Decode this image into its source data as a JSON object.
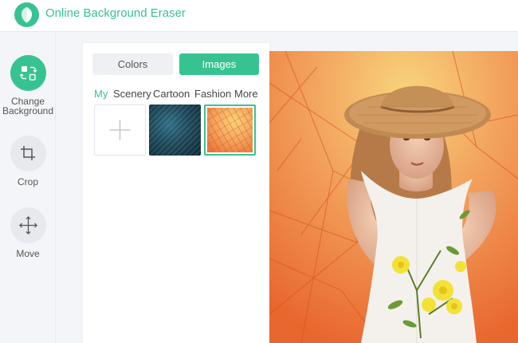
{
  "app": {
    "title": "Online Background Eraser",
    "brand_color": "#37c391"
  },
  "toolbar": {
    "items": [
      {
        "label": "Change Background",
        "icon": "change-background-icon",
        "active": true
      },
      {
        "label": "Crop",
        "icon": "crop-icon",
        "active": false
      },
      {
        "label": "Move",
        "icon": "move-icon",
        "active": false
      }
    ]
  },
  "panel": {
    "tabs": [
      {
        "label": "Colors",
        "active": false
      },
      {
        "label": "Images",
        "active": true
      }
    ],
    "categories": [
      {
        "label": "My",
        "active": true
      },
      {
        "label": "Scenery",
        "active": false
      },
      {
        "label": "Cartoon",
        "active": false
      },
      {
        "label": "Fashion",
        "active": false
      },
      {
        "label": "More",
        "active": false
      }
    ],
    "thumbnails": [
      {
        "name": "add-image",
        "icon": "plus-icon",
        "selected": false
      },
      {
        "name": "blue-texture",
        "selected": false
      },
      {
        "name": "orange-leaves",
        "selected": true
      }
    ]
  },
  "canvas": {
    "content": "woman-in-hat-holding-yellow-flowers-on-orange-leaf-background"
  }
}
